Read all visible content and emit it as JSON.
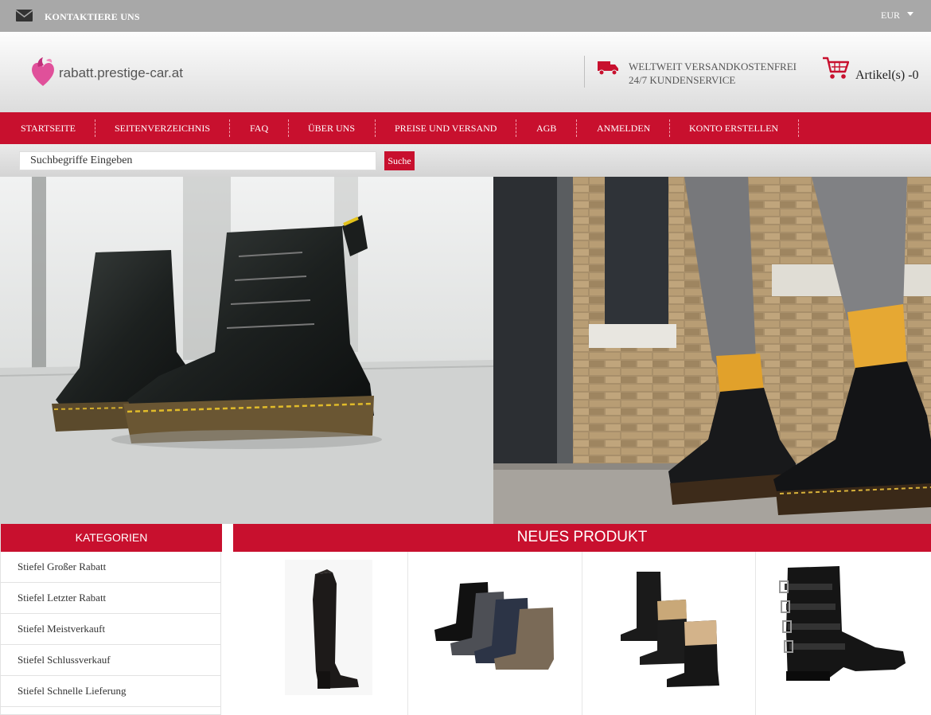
{
  "topbar": {
    "contact_label": "KONTAKTIERE UNS",
    "currency": "EUR",
    "icons": [
      "mail-icon",
      "chevron-down-icon"
    ]
  },
  "header": {
    "logo_text": "rabatt.prestige-car.at",
    "shipping_line1": "WELTWEIT VERSANDKOSTENFREI",
    "shipping_line2": "24/7 KUNDENSERVICE",
    "cart_label": "Artikel(s) -0",
    "icons": [
      "logo-heart-icon",
      "truck-icon",
      "cart-icon"
    ]
  },
  "nav": {
    "items": [
      {
        "label": "STARTSEITE"
      },
      {
        "label": "SEITENVERZEICHNIS"
      },
      {
        "label": "FAQ"
      },
      {
        "label": "ÜBER UNS"
      },
      {
        "label": "PREISE UND VERSAND"
      },
      {
        "label": "AGB"
      },
      {
        "label": "ANMELDEN"
      },
      {
        "label": "KONTO ERSTELLEN"
      }
    ]
  },
  "search": {
    "value": "Suchbegriffe Eingeben",
    "button_label": "Suche"
  },
  "categories": {
    "title": "KATEGORIEN",
    "items": [
      {
        "label": "Stiefel Großer Rabatt"
      },
      {
        "label": "Stiefel Letzter Rabatt"
      },
      {
        "label": "Stiefel Meistverkauft"
      },
      {
        "label": "Stiefel Schlussverkauf"
      },
      {
        "label": "Stiefel Schnelle Lieferung"
      }
    ]
  },
  "products": {
    "title": "NEUES PRODUKT",
    "items": [
      {
        "image": "tall-riding-boot"
      },
      {
        "image": "slouch-ankle-boots-set"
      },
      {
        "image": "shearling-boots-set"
      },
      {
        "image": "buckle-biker-boot"
      }
    ]
  },
  "colors": {
    "brand_red": "#c8102e",
    "topbar_gray": "#a8a8a8"
  }
}
